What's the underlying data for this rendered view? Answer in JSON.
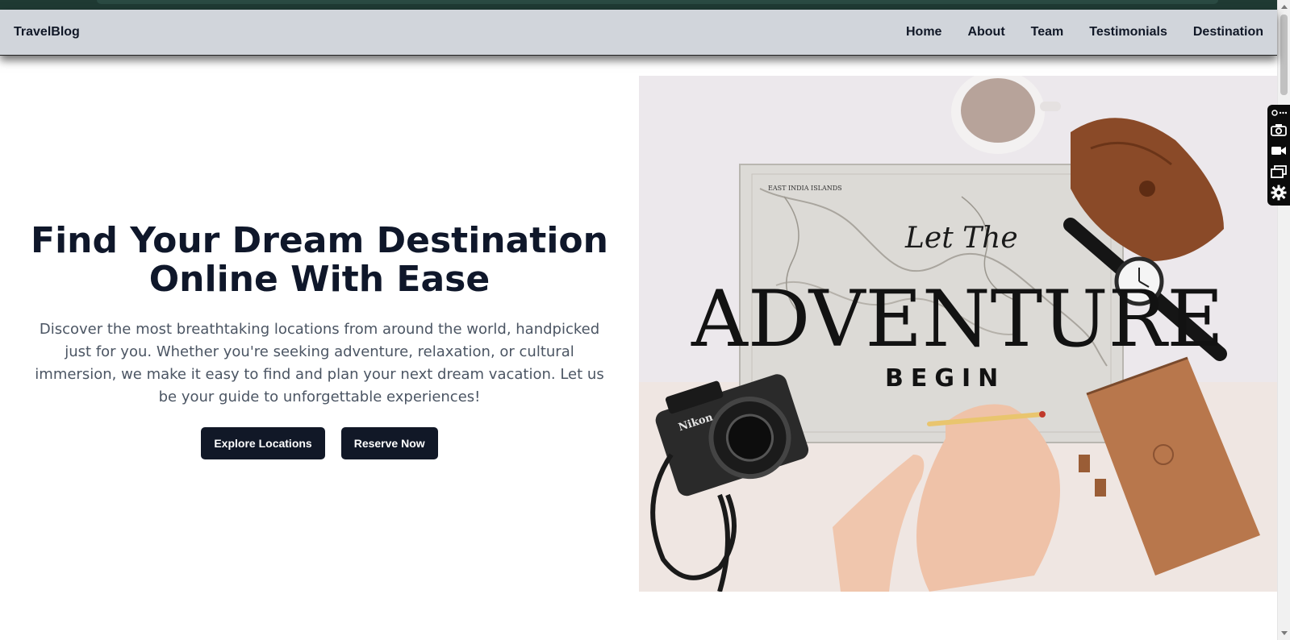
{
  "site": {
    "brand": "TravelBlog"
  },
  "nav": {
    "links": [
      "Home",
      "About",
      "Team",
      "Testimonials",
      "Destination"
    ]
  },
  "hero": {
    "title_line1": "Find Your Dream Destination",
    "title_line2": "Online With Ease",
    "description": "Discover the most breathtaking locations from around the world, handpicked just for you. Whether you're seeking adventure, relaxation, or cultural immersion, we make it easy to find and plan your next dream vacation. Let us be your guide to unforgettable experiences!",
    "buttons": {
      "explore": "Explore Locations",
      "reserve": "Reserve Now"
    },
    "image": {
      "text_small": "Let The",
      "text_big": "ADVENTURE",
      "text_sub": "BEGIN",
      "map_label": "EAST INDIA ISLANDS",
      "camera_brand": "Nikon"
    }
  },
  "toolbar": {
    "icons": [
      "link-icon",
      "camera-icon",
      "video-icon",
      "windows-icon",
      "gear-icon"
    ]
  },
  "colors": {
    "navbar_bg": "#d1d5db",
    "button_bg": "#111827",
    "title": "#0f172a",
    "body_text": "#4b5563"
  }
}
